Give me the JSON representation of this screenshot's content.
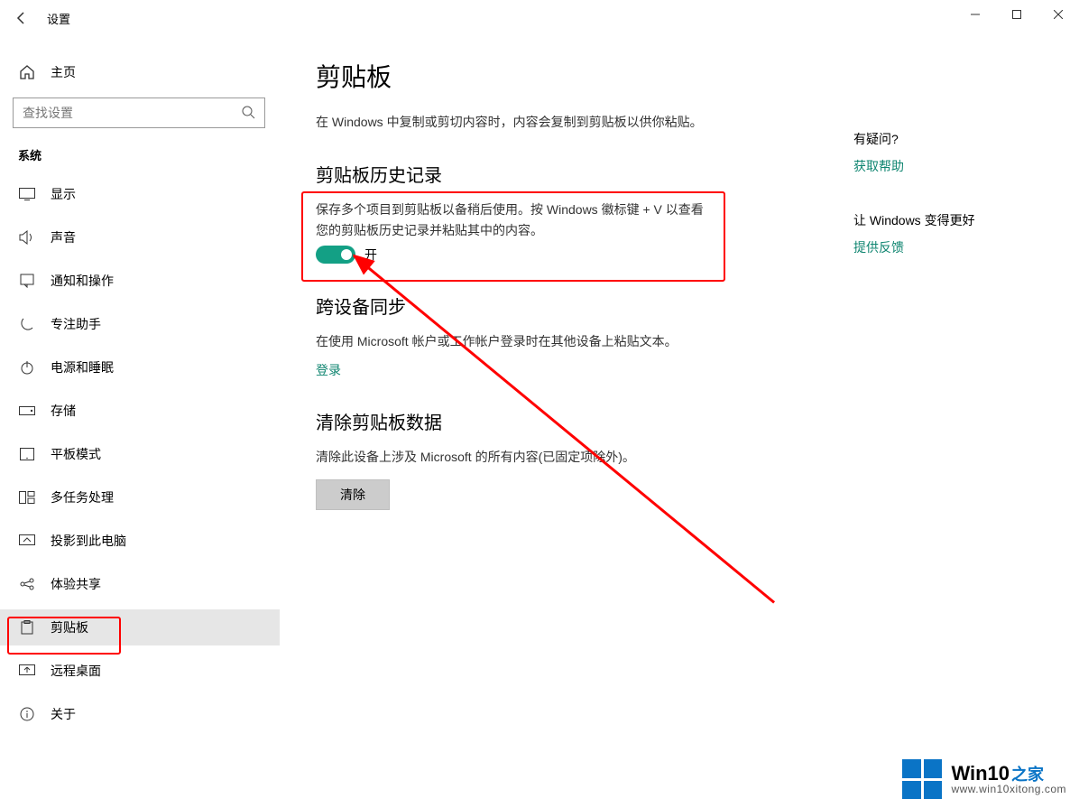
{
  "window": {
    "title": "设置"
  },
  "sidebar": {
    "home": "主页",
    "search_placeholder": "查找设置",
    "section_label": "系统",
    "items": [
      {
        "label": "显示",
        "icon": "display-icon"
      },
      {
        "label": "声音",
        "icon": "sound-icon"
      },
      {
        "label": "通知和操作",
        "icon": "notifications-icon"
      },
      {
        "label": "专注助手",
        "icon": "focus-assist-icon"
      },
      {
        "label": "电源和睡眠",
        "icon": "power-icon"
      },
      {
        "label": "存储",
        "icon": "storage-icon"
      },
      {
        "label": "平板模式",
        "icon": "tablet-icon"
      },
      {
        "label": "多任务处理",
        "icon": "multitask-icon"
      },
      {
        "label": "投影到此电脑",
        "icon": "project-icon"
      },
      {
        "label": "体验共享",
        "icon": "shared-icon"
      },
      {
        "label": "剪贴板",
        "icon": "clipboard-icon"
      },
      {
        "label": "远程桌面",
        "icon": "remote-icon"
      },
      {
        "label": "关于",
        "icon": "about-icon"
      }
    ]
  },
  "main": {
    "title": "剪贴板",
    "intro": "在 Windows 中复制或剪切内容时，内容会复制到剪贴板以供你粘贴。",
    "history_heading": "剪贴板历史记录",
    "history_text": "保存多个项目到剪贴板以备稍后使用。按 Windows 徽标键 + V 以查看您的剪贴板历史记录并粘贴其中的内容。",
    "history_toggle_state": "开",
    "sync_heading": "跨设备同步",
    "sync_text": "在使用 Microsoft 帐户或工作帐户登录时在其他设备上粘贴文本。",
    "sync_link": "登录",
    "clear_heading": "清除剪贴板数据",
    "clear_text": "清除此设备上涉及 Microsoft 的所有内容(已固定项除外)。",
    "clear_button": "清除"
  },
  "right": {
    "q": "有疑问?",
    "help_link": "获取帮助",
    "better_heading": "让 Windows 变得更好",
    "feedback_link": "提供反馈"
  },
  "watermark": {
    "brand_main": "Win10",
    "brand_accent": "之家",
    "url": "www.win10xitong.com"
  }
}
